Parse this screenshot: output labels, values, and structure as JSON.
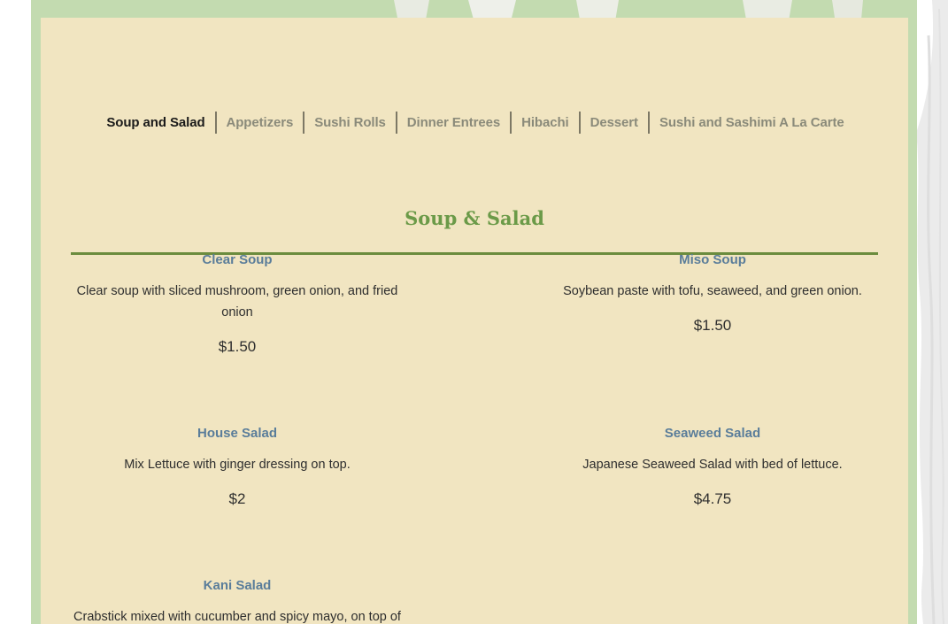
{
  "tabs": [
    {
      "label": "Soup and Salad",
      "active": true
    },
    {
      "label": "Appetizers"
    },
    {
      "label": "Sushi Rolls"
    },
    {
      "label": "Dinner Entrees"
    },
    {
      "label": "Hibachi"
    },
    {
      "label": "Dessert"
    },
    {
      "label": "Sushi and Sashimi A La Carte"
    }
  ],
  "section": {
    "title": "Soup & Salad"
  },
  "items": [
    {
      "name": "Clear Soup",
      "description": "Clear soup with sliced mushroom, green onion, and fried onion",
      "price": "$1.50"
    },
    {
      "name": "Miso Soup",
      "description": "Soybean paste with tofu, seaweed, and green onion.",
      "price": "$1.50"
    },
    {
      "name": "House Salad",
      "description": "Mix Lettuce with ginger dressing on top.",
      "price": "$2"
    },
    {
      "name": "Seaweed Salad",
      "description": "Japanese Seaweed Salad with bed of lettuce.",
      "price": "$4.75"
    },
    {
      "name": "Kani Salad",
      "description": "Crabstick mixed with cucumber and spicy mayo, on top of",
      "price": ""
    }
  ],
  "colors": {
    "frame_green": "#c3dbb0",
    "panel_cream": "#f1e5c1",
    "title_green": "#6b9a48",
    "item_name_blue": "#5a7d9a"
  }
}
